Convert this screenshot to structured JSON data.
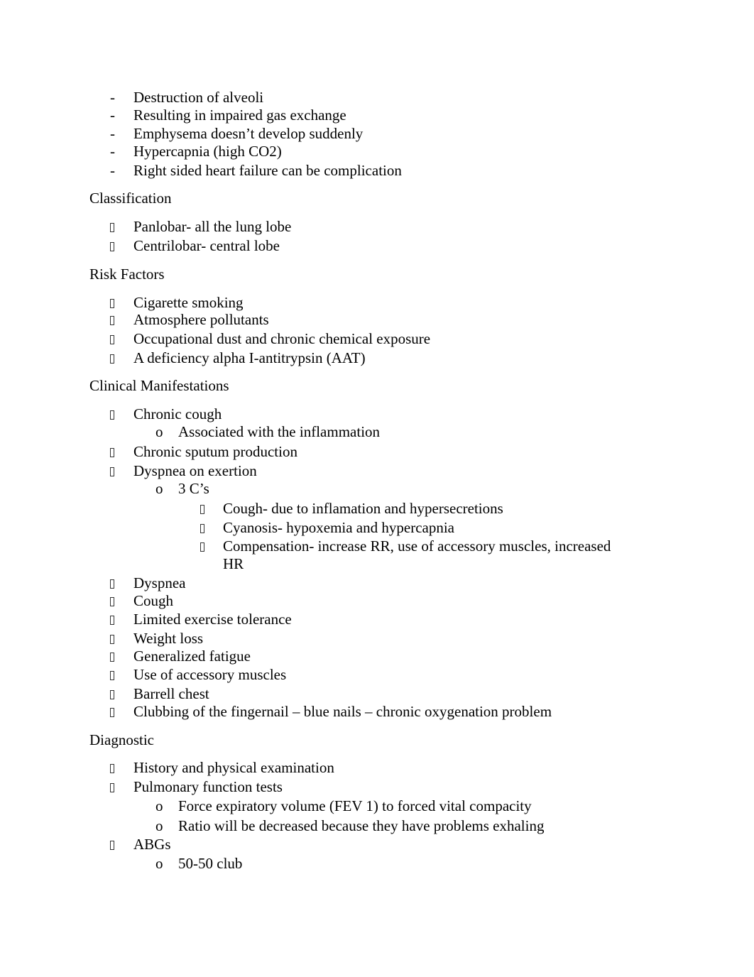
{
  "document": {
    "intro_list": [
      "Destruction of alveoli",
      "Resulting in impaired gas exchange",
      "Emphysema doesn’t develop suddenly",
      "Hypercapnia (high CO2)",
      "Right sided heart failure can be complication"
    ],
    "dash_marker": "-",
    "sub_marker": "o",
    "bullet_icon": "missing-glyph-box",
    "sections": {
      "classification": {
        "heading": "Classification",
        "items": [
          "Panlobar- all the lung lobe",
          "Centrilobar- central lobe"
        ]
      },
      "risk_factors": {
        "heading": "Risk Factors",
        "items": [
          "Cigarette smoking",
          "Atmosphere pollutants",
          "Occupational dust and chronic chemical exposure",
          "A deficiency alpha I-antitrypsin (AAT)"
        ]
      },
      "clinical": {
        "heading": "Clinical Manifestations",
        "chronic_cough": "Chronic cough",
        "chronic_cough_sub": "Associated with the inflammation",
        "sputum": "Chronic sputum production",
        "dyspnea_exertion": "Dyspnea on exertion",
        "three_cs": "3 C’s",
        "three_cs_items": [
          "Cough- due to inflamation and hypersecretions",
          "Cyanosis- hypoxemia and hypercapnia",
          "Compensation- increase RR, use of accessory muscles, increased",
          "HR"
        ],
        "items": [
          "Dyspnea",
          "Cough",
          "Limited exercise tolerance",
          "Weight loss",
          "Generalized fatigue",
          "Use of accessory muscles",
          "Barrell chest",
          "Clubbing of the fingernail – blue nails – chronic oxygenation problem"
        ]
      },
      "diagnostic": {
        "heading": "Diagnostic",
        "history": "History and physical examination",
        "pft": "Pulmonary function tests",
        "pft_sub": [
          "Force expiratory volume (FEV 1) to forced vital compacity",
          "Ratio will be decreased because they have problems exhaling"
        ],
        "abgs": "ABGs",
        "abgs_sub": "50-50 club"
      }
    }
  }
}
